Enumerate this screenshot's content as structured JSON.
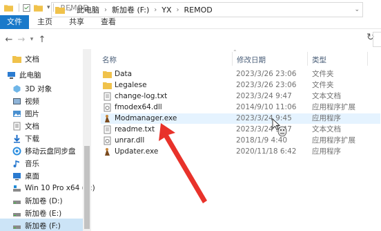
{
  "window": {
    "title": "REMOD"
  },
  "ribbon": {
    "tabs": [
      "文件",
      "主页",
      "共享",
      "查看"
    ]
  },
  "address": {
    "crumbs": [
      "此电脑",
      "新加卷 (F:)",
      "YX",
      "REMOD"
    ]
  },
  "nav": {
    "items": [
      {
        "label": "文档",
        "icon": "folder-icon"
      },
      {
        "label": "此电脑",
        "icon": "computer-icon"
      },
      {
        "label": "3D 对象",
        "icon": "3d-objects-icon"
      },
      {
        "label": "视频",
        "icon": "video-icon"
      },
      {
        "label": "图片",
        "icon": "picture-icon"
      },
      {
        "label": "文档",
        "icon": "document-icon"
      },
      {
        "label": "下载",
        "icon": "download-icon"
      },
      {
        "label": "移动云盘同步盘",
        "icon": "cloud-sync-icon"
      },
      {
        "label": "音乐",
        "icon": "music-icon"
      },
      {
        "label": "桌面",
        "icon": "desktop-icon"
      },
      {
        "label": "Win 10 Pro x64 (C:)",
        "icon": "system-drive-icon"
      },
      {
        "label": "新加卷 (D:)",
        "icon": "drive-icon"
      },
      {
        "label": "新加卷 (E:)",
        "icon": "drive-icon"
      },
      {
        "label": "新加卷 (F:)",
        "icon": "drive-icon"
      }
    ]
  },
  "columns": {
    "name": "名称",
    "date": "修改日期",
    "type": "类型"
  },
  "files": [
    {
      "name": "Data",
      "date": "2023/3/26 23:06",
      "type": "文件夹",
      "icon": "folder-icon"
    },
    {
      "name": "Legalese",
      "date": "2023/3/26 23:06",
      "type": "文件夹",
      "icon": "folder-icon"
    },
    {
      "name": "change-log.txt",
      "date": "2023/3/24 9:47",
      "type": "文本文档",
      "icon": "text-file-icon"
    },
    {
      "name": "fmodex64.dll",
      "date": "2014/9/10 11:06",
      "type": "应用程序扩展",
      "icon": "dll-file-icon"
    },
    {
      "name": "Modmanager.exe",
      "date": "2023/3/24 9:45",
      "type": "应用程序",
      "icon": "app-exe-icon"
    },
    {
      "name": "readme.txt",
      "date": "2023/3/24 9:47",
      "type": "文本文档",
      "icon": "text-file-icon"
    },
    {
      "name": "unrar.dll",
      "date": "2018/1/9 4:40",
      "type": "应用程序扩展",
      "icon": "dll-file-icon"
    },
    {
      "name": "Updater.exe",
      "date": "2020/11/18 6:42",
      "type": "应用程序",
      "icon": "app-exe-icon"
    }
  ],
  "colors": {
    "accent": "#1979ca",
    "folder": "#f0c24b",
    "selection": "#cce4f7",
    "hover": "#e5f3ff",
    "annotation_arrow": "#e8322a"
  }
}
